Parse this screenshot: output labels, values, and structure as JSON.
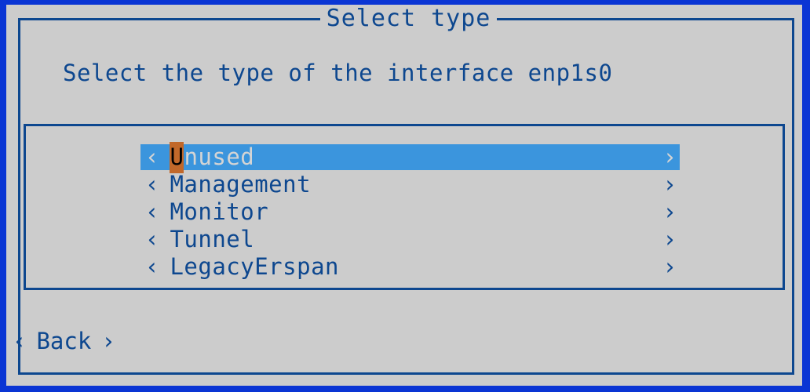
{
  "window": {
    "title": "Select type",
    "accent_blue": "#0a35d4",
    "frame_navy": "#0d478f",
    "background_gray": "#cccccc",
    "highlight_blue": "#3b95dd",
    "cursor_orange": "#c1682a",
    "selected_text": "#d4d4d4"
  },
  "prompt": {
    "text": "Select the type of the interface enp1s0"
  },
  "list": {
    "left_chevron": "‹",
    "right_chevron": "›",
    "items": [
      {
        "label": "Unused",
        "cursor_char": "U",
        "rest": "nused",
        "selected": true
      },
      {
        "label": "Management",
        "cursor_char": "",
        "rest": "Management",
        "selected": false
      },
      {
        "label": "Monitor",
        "cursor_char": "",
        "rest": "Monitor",
        "selected": false
      },
      {
        "label": "Tunnel",
        "cursor_char": "",
        "rest": "Tunnel",
        "selected": false
      },
      {
        "label": "LegacyErspan",
        "cursor_char": "",
        "rest": "LegacyErspan",
        "selected": false
      }
    ]
  },
  "footer": {
    "back_label": "Back",
    "left_chevron": "‹",
    "right_chevron": "›"
  }
}
